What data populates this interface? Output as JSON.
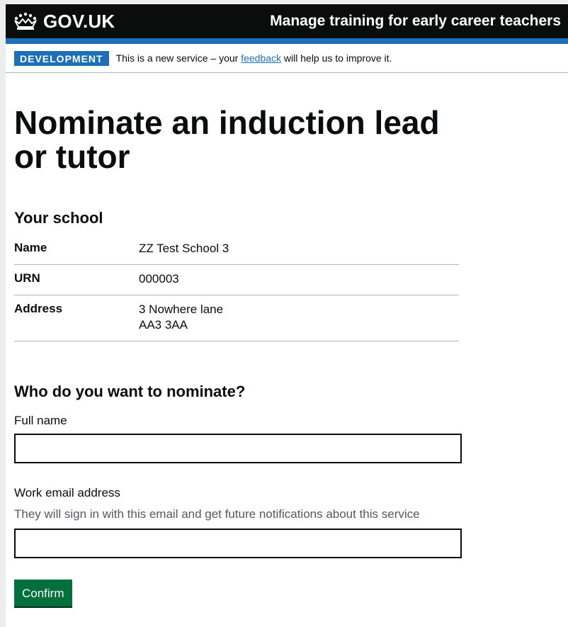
{
  "header": {
    "logo_text": "GOV.UK",
    "service_name": "Manage training for early career teachers"
  },
  "phase_banner": {
    "tag": "DEVELOPMENT",
    "text_before": "This is a new service – your",
    "link_text": "feedback",
    "text_after": "will help us to improve it."
  },
  "page": {
    "title": "Nominate an induction lead or tutor"
  },
  "school": {
    "heading": "Your school",
    "rows": [
      {
        "key": "Name",
        "value": "ZZ Test School 3"
      },
      {
        "key": "URN",
        "value": "000003"
      },
      {
        "key": "Address",
        "value_line1": "3 Nowhere lane",
        "value_line2": "AA3 3AA"
      }
    ]
  },
  "nominate": {
    "heading": "Who do you want to nominate?",
    "full_name_label": "Full name",
    "full_name_value": "",
    "email_label": "Work email address",
    "email_hint": "They will sign in with this email and get future notifications about this service",
    "email_value": "",
    "confirm_label": "Confirm"
  },
  "colors": {
    "header_bg": "#0b0c0c",
    "brand_blue": "#1d70b8",
    "button_green": "#00703c",
    "hint_grey": "#505a5f"
  }
}
